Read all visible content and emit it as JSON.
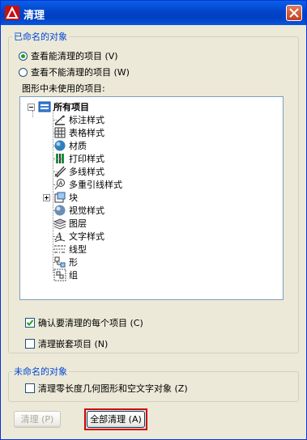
{
  "window": {
    "title": "清理"
  },
  "named_group": {
    "legend": "已命名的对象",
    "radio_purgeable": "查看能清理的项目 (V)",
    "radio_nonpurgeable": "查看不能清理的项目 (W)",
    "tree_label": "图形中未使用的项目:",
    "tree": {
      "root": "所有项目",
      "items": [
        "标注样式",
        "表格样式",
        "材质",
        "打印样式",
        "多线样式",
        "多重引线样式",
        "块",
        "视觉样式",
        "图层",
        "文字样式",
        "线型",
        "形",
        "组"
      ]
    },
    "confirm_label": "确认要清理的每个项目 (C)",
    "nested_label": "清理嵌套项目 (N)"
  },
  "unnamed_group": {
    "legend": "未命名的对象",
    "zero_length_label": "清理零长度几何图形和空文字对象 (Z)"
  },
  "buttons": {
    "purge": "清理 (P)",
    "purge_all": "全部清理 (A)"
  },
  "state": {
    "radio_selected": "purgeable",
    "confirm_checked": true,
    "nested_checked": false,
    "zero_checked": false
  },
  "colors": {
    "titlebar": "#0040c0",
    "legend": "#0046d5",
    "highlight": "#d00000",
    "check": "#21a121"
  }
}
